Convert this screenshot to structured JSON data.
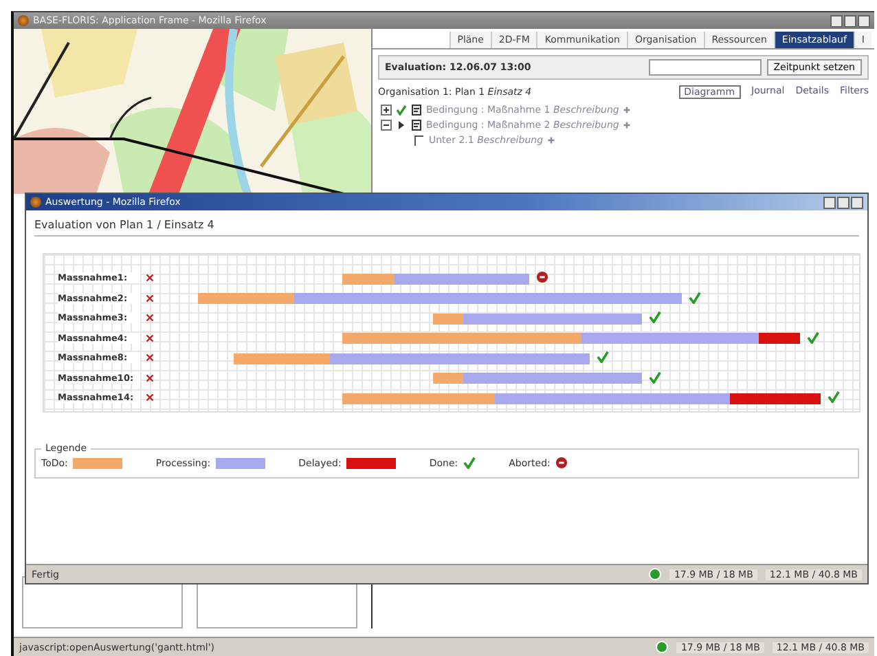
{
  "outer_window": {
    "title": "BASE-FLORIS: Application Frame - Mozilla Firefox"
  },
  "tabs": [
    {
      "label": "Pläne",
      "selected": false
    },
    {
      "label": "2D-FM",
      "selected": false
    },
    {
      "label": "Kommunikation",
      "selected": false
    },
    {
      "label": "Organisation",
      "selected": false
    },
    {
      "label": "Ressourcen",
      "selected": false
    },
    {
      "label": "Einsatzablauf",
      "selected": true
    },
    {
      "label": "I",
      "selected": false
    }
  ],
  "evaluation": {
    "label": "Evaluation: 12.06.07 13:00",
    "button": "Zeitpunkt setzen"
  },
  "organisation": "Organisation 1: Plan 1 *Einsatz 4*",
  "view_links": [
    {
      "label": "Diagramm",
      "selected": true
    },
    {
      "label": "Journal",
      "selected": false
    },
    {
      "label": "Details",
      "selected": false
    },
    {
      "label": "Filters",
      "selected": false
    }
  ],
  "tree": [
    {
      "label": "Bedingung : Maßnahme 1 *Beschreibung*",
      "kind": "done",
      "expanded": false
    },
    {
      "label": "Bedingung : Maßnahme 2 *Beschreibung*",
      "kind": "running",
      "expanded": true,
      "children": [
        {
          "label": "Unter 2.1 *Beschreibung*"
        }
      ]
    }
  ],
  "inner_window": {
    "title": "Auswertung - Mozilla Firefox",
    "heading": "Evaluation von Plan 1 / Einsatz 4"
  },
  "tasks": [
    {
      "name": "Massnahme1:",
      "kind": "aborted",
      "segments": [
        {
          "kind": "todo"
        },
        {
          "kind": "processing"
        }
      ]
    },
    {
      "name": "Massnahme2:",
      "kind": "done",
      "segments": [
        {
          "kind": "todo"
        },
        {
          "kind": "processing"
        }
      ]
    },
    {
      "name": "Massnahme3:",
      "kind": "done",
      "segments": [
        {
          "kind": "todo"
        },
        {
          "kind": "processing"
        }
      ]
    },
    {
      "name": "Massnahme4:",
      "kind": "done",
      "segments": [
        {
          "kind": "todo"
        },
        {
          "kind": "processing"
        },
        {
          "kind": "delayed"
        }
      ]
    },
    {
      "name": "Massnahme8:",
      "kind": "done",
      "segments": [
        {
          "kind": "todo"
        },
        {
          "kind": "processing"
        }
      ]
    },
    {
      "name": "Massnahme10:",
      "kind": "done",
      "segments": [
        {
          "kind": "todo"
        },
        {
          "kind": "processing"
        }
      ]
    },
    {
      "name": "Massnahme14:",
      "kind": "done",
      "segments": [
        {
          "kind": "todo"
        },
        {
          "kind": "processing"
        },
        {
          "kind": "delayed"
        }
      ]
    }
  ],
  "legend": {
    "title": "Legende",
    "items": [
      {
        "label": "ToDo:",
        "kind": "todo",
        "color": "#f2a96a"
      },
      {
        "label": "Processing:",
        "kind": "processing",
        "color": "#a8a8ee"
      },
      {
        "label": "Delayed:",
        "kind": "delayed",
        "color": "#d81010"
      },
      {
        "label": "Done:",
        "kind": "done"
      },
      {
        "label": "Aborted:",
        "kind": "aborted"
      }
    ]
  },
  "inner_status": {
    "text": "Fertig",
    "memory_1": "17.9 MB / 18 MB",
    "memory_2": "12.1 MB / 40.8 MB"
  },
  "outer_status": {
    "text": "javascript:openAuswertung('gantt.html')",
    "memory_1": "17.9 MB / 18 MB",
    "memory_2": "12.1 MB / 40.8 MB"
  }
}
